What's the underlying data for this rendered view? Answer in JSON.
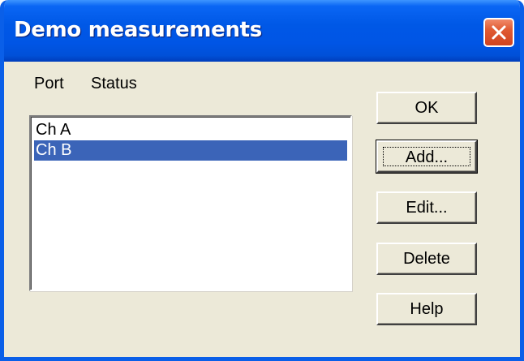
{
  "window": {
    "title": "Demo measurements"
  },
  "headers": {
    "port": "Port",
    "status": "Status"
  },
  "list": {
    "items": [
      {
        "label": "Ch A",
        "selected": false
      },
      {
        "label": "Ch B",
        "selected": true
      }
    ]
  },
  "buttons": {
    "ok": "OK",
    "add": "Add...",
    "edit": "Edit...",
    "delete": "Delete",
    "help": "Help"
  },
  "colors": {
    "title_bar": "#0055e5",
    "dialog_bg": "#ece9d8",
    "selection": "#3b64b8",
    "close_button": "#e05a32"
  },
  "icons": {
    "close": "close-icon"
  }
}
